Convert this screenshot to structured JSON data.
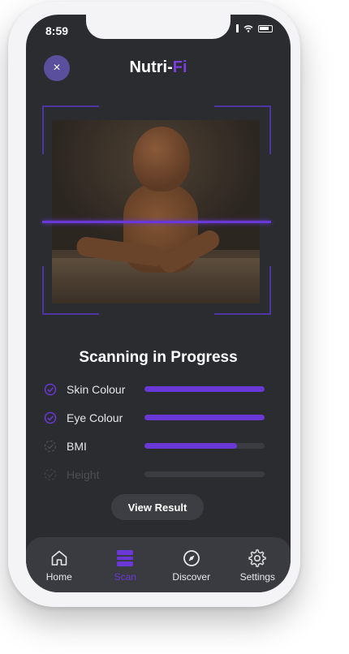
{
  "status": {
    "time": "8:59"
  },
  "header": {
    "close_label": "×",
    "title_main": "Nutri-",
    "title_accent": "Fi"
  },
  "scan": {
    "heading": "Scanning in Progress",
    "metrics": [
      {
        "label": "Skin Colour",
        "progress": 1.0,
        "checked": true
      },
      {
        "label": "Eye Colour",
        "progress": 1.0,
        "checked": true
      },
      {
        "label": "BMI",
        "progress": 0.77,
        "checked": false
      },
      {
        "label": "Height",
        "progress": 0.0,
        "checked": false
      }
    ]
  },
  "actions": {
    "view_result": "View Result"
  },
  "nav": {
    "items": [
      {
        "label": "Home",
        "icon": "home-icon"
      },
      {
        "label": "Scan",
        "icon": "scan-icon"
      },
      {
        "label": "Discover",
        "icon": "compass-icon"
      },
      {
        "label": "Settings",
        "icon": "gear-icon"
      }
    ],
    "active": "Scan"
  },
  "colors": {
    "accent": "#6a38d6",
    "background": "#2b2c30",
    "nav": "#3a3b40"
  }
}
